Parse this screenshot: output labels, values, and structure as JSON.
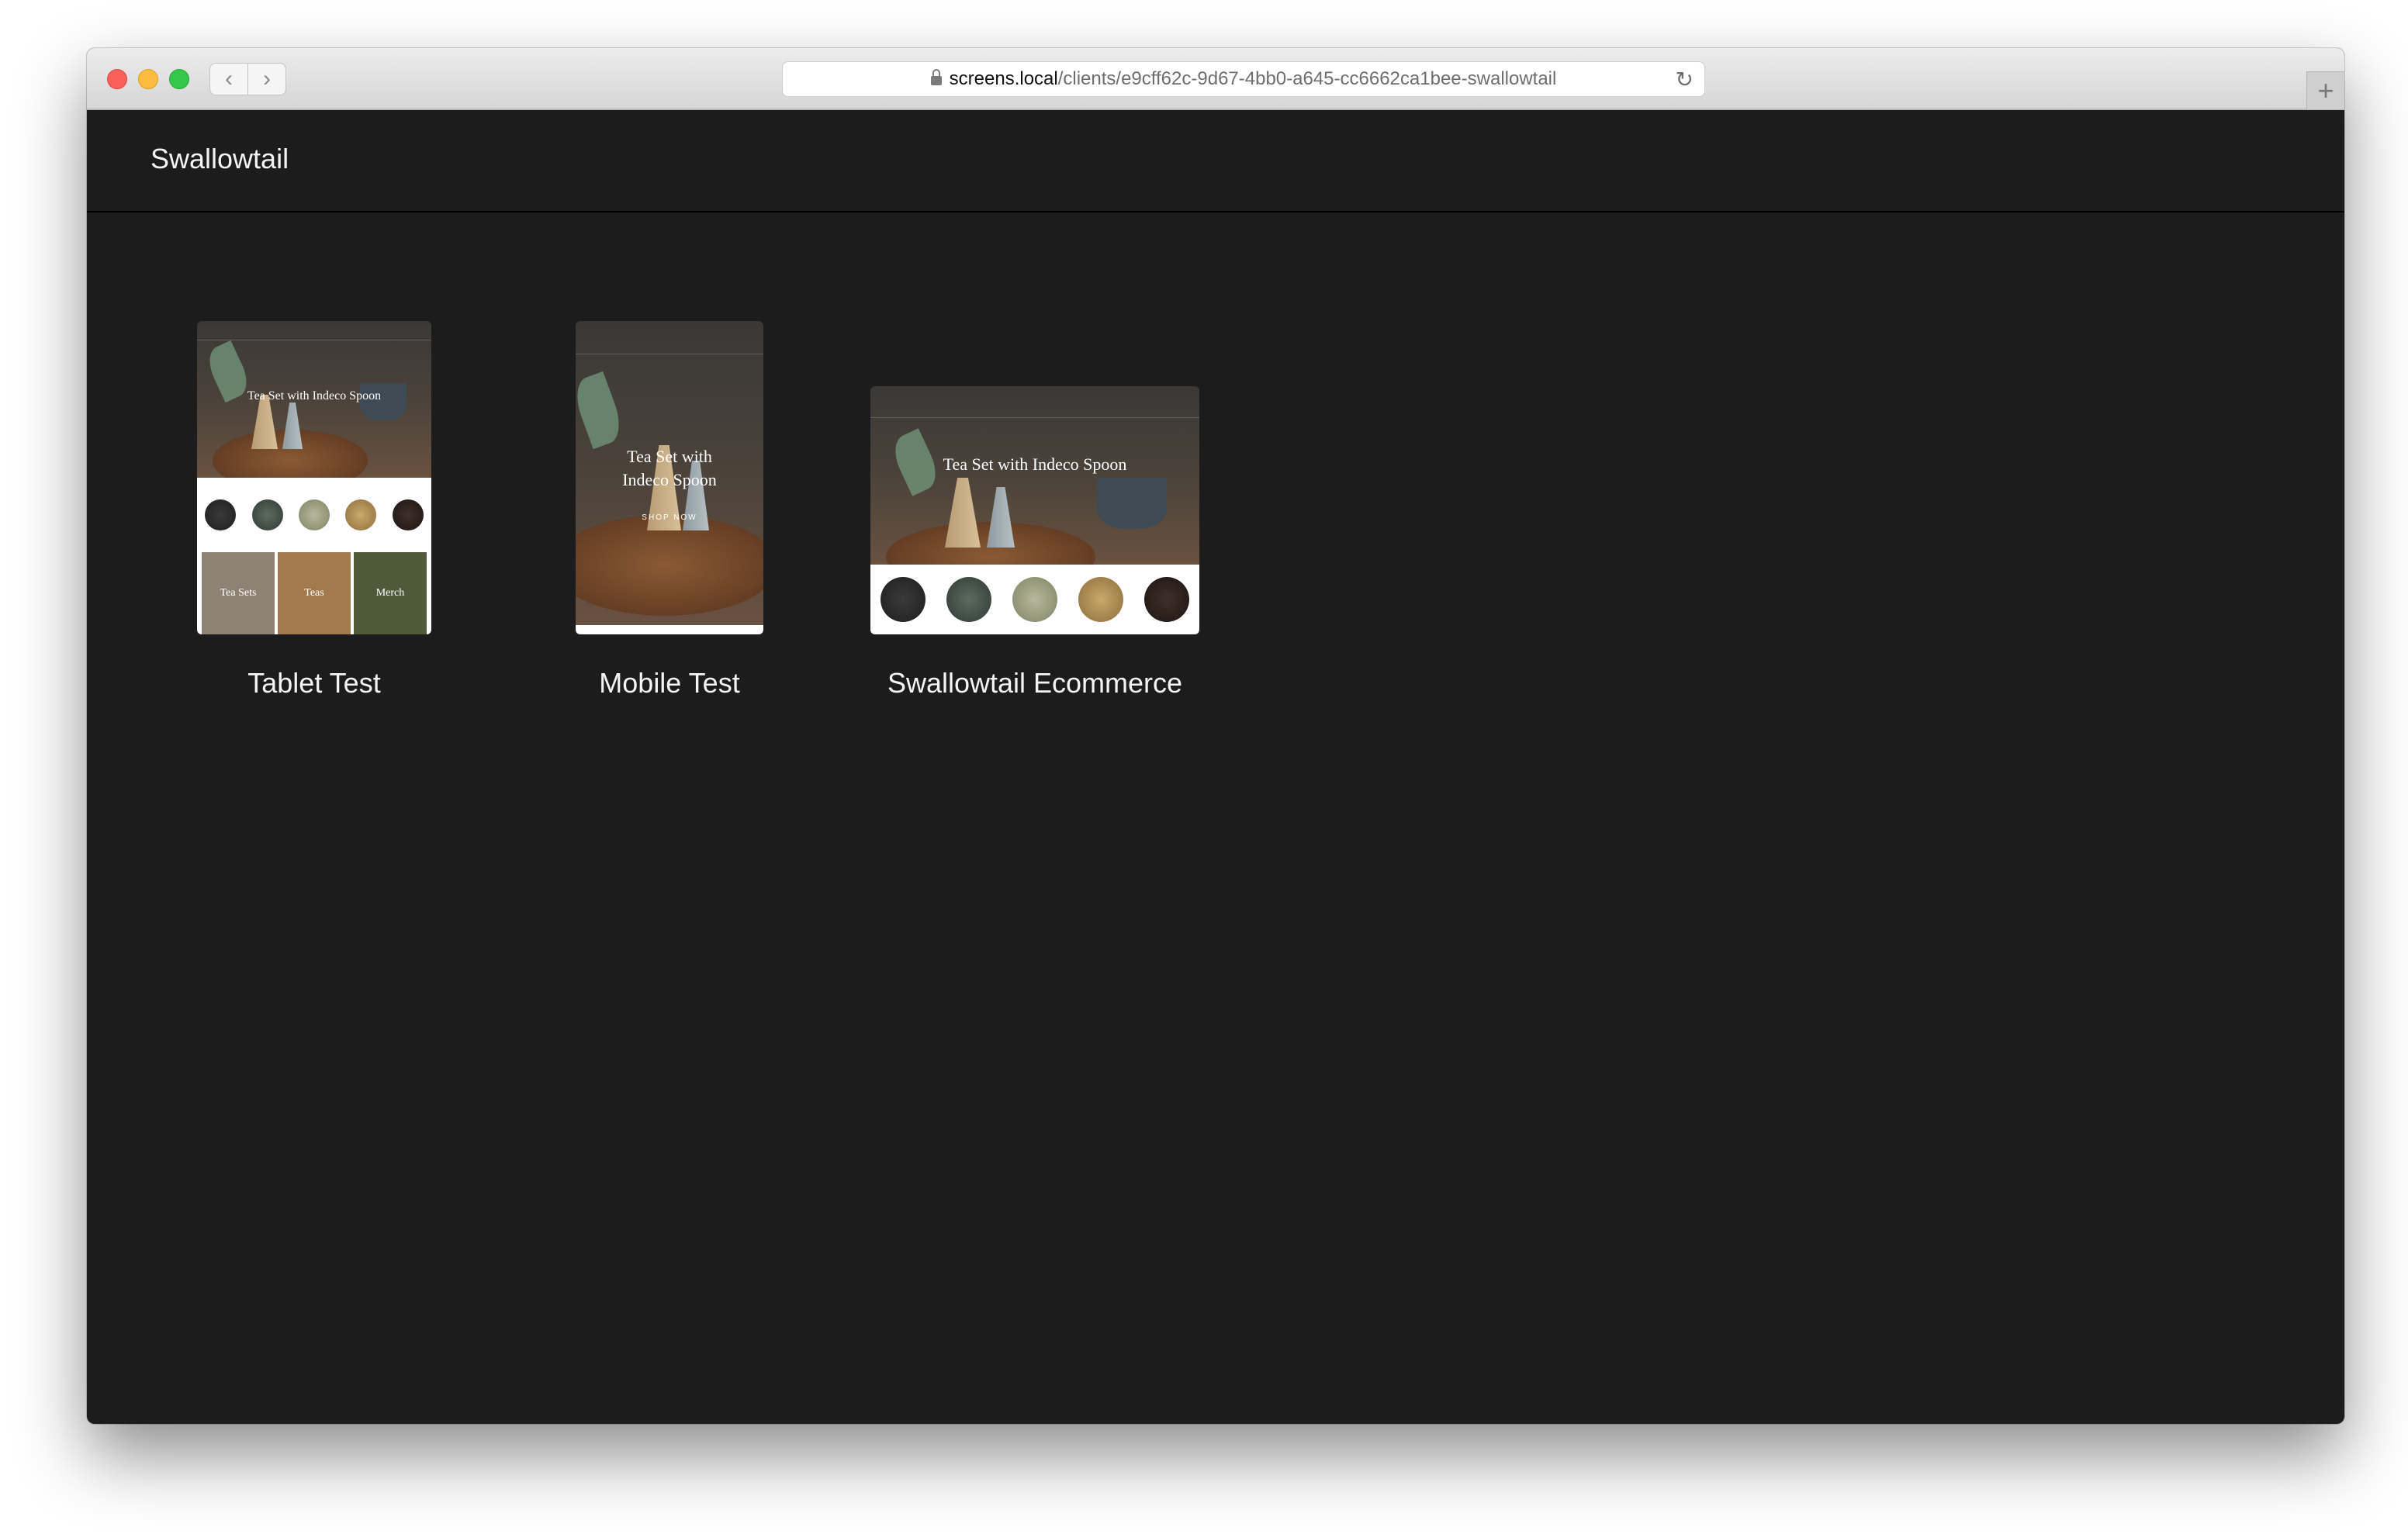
{
  "browser": {
    "url_host": "screens.local",
    "url_path": "/clients/e9cff62c-9d67-4bb0-a645-cc6662ca1bee-swallowtail",
    "back_icon": "chevron-left",
    "forward_icon": "chevron-right",
    "reload_icon": "reload",
    "new_tab_icon": "plus"
  },
  "app": {
    "brand": "Swallowtail"
  },
  "screens": [
    {
      "name": "Tablet Test",
      "hero_text": "Tea Set with Indeco Spoon",
      "tiles": [
        "Tea Sets",
        "Teas",
        "Merch"
      ]
    },
    {
      "name": "Mobile Test",
      "hero_text": "Tea Set with Indeco Spoon",
      "cta": "SHOP NOW"
    },
    {
      "name": "Swallowtail Ecommerce",
      "hero_text": "Tea Set with Indeco Spoon"
    }
  ]
}
